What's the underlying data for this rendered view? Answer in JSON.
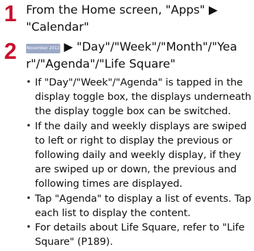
{
  "steps": [
    {
      "number": "1",
      "text": "From the Home screen, \"Apps\" ▶ \"Calendar\""
    },
    {
      "number": "2",
      "chip_label": "November 2012",
      "text": "▶ \"Day\"/\"Week\"/\"Month\"/\"Yea r\"/\"Agenda\"/\"Life Square\""
    }
  ],
  "bullets": [
    "If \"Day\"/\"Week\"/\"Agenda\" is tapped in the display toggle box, the displays underneath the display toggle box can be switched.",
    "If the daily and weekly displays are swiped to left or right to display the previous or following daily and weekly display, if they are swiped up or down, the previous and following times are displayed.",
    "Tap \"Agenda\" to display a list of events. Tap each list to display the content.",
    "For details about Life Square, refer to \"Life Square\" (P189)."
  ]
}
